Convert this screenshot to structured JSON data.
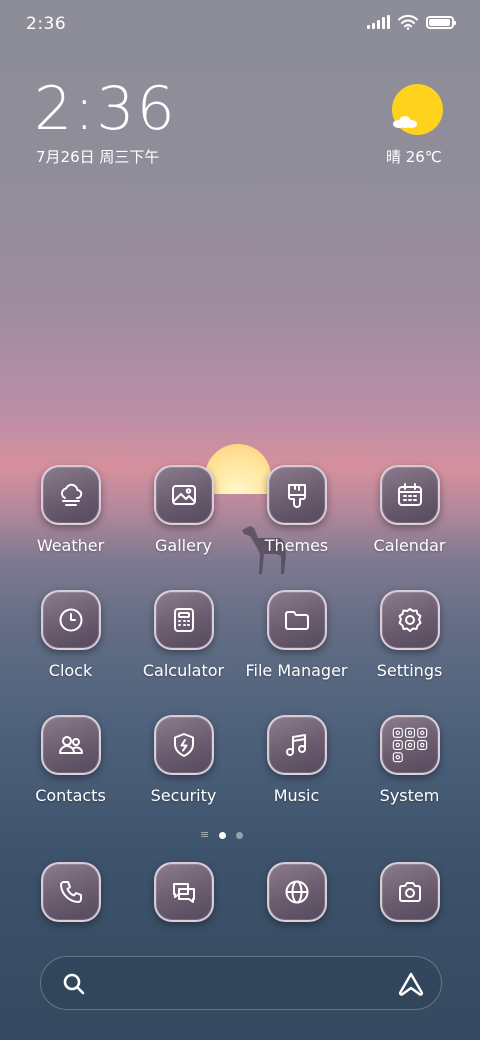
{
  "status_bar": {
    "time": "2:36",
    "battery_level": 0.95
  },
  "lock_widget": {
    "time": "2:36",
    "date": "7月26日 周三下午",
    "weather": "晴 26℃",
    "colors": {
      "sun": "#ffd21e"
    }
  },
  "apps": [
    {
      "label": "Weather",
      "icon": "weather-icon"
    },
    {
      "label": "Gallery",
      "icon": "gallery-icon"
    },
    {
      "label": "Themes",
      "icon": "themes-icon"
    },
    {
      "label": "Calendar",
      "icon": "calendar-icon"
    },
    {
      "label": "Clock",
      "icon": "clock-icon"
    },
    {
      "label": "Calculator",
      "icon": "calculator-icon"
    },
    {
      "label": "File Manager",
      "icon": "folder-icon"
    },
    {
      "label": "Settings",
      "icon": "gear-icon"
    },
    {
      "label": "Contacts",
      "icon": "contacts-icon"
    },
    {
      "label": "Security",
      "icon": "shield-icon"
    },
    {
      "label": "Music",
      "icon": "music-icon"
    },
    {
      "label": "System",
      "icon": "folder-system-icon"
    }
  ],
  "page_indicator": {
    "pages": 2,
    "current": 1
  },
  "dock": [
    {
      "icon": "phone-icon"
    },
    {
      "icon": "messages-icon"
    },
    {
      "icon": "browser-icon"
    },
    {
      "icon": "camera-icon"
    }
  ]
}
